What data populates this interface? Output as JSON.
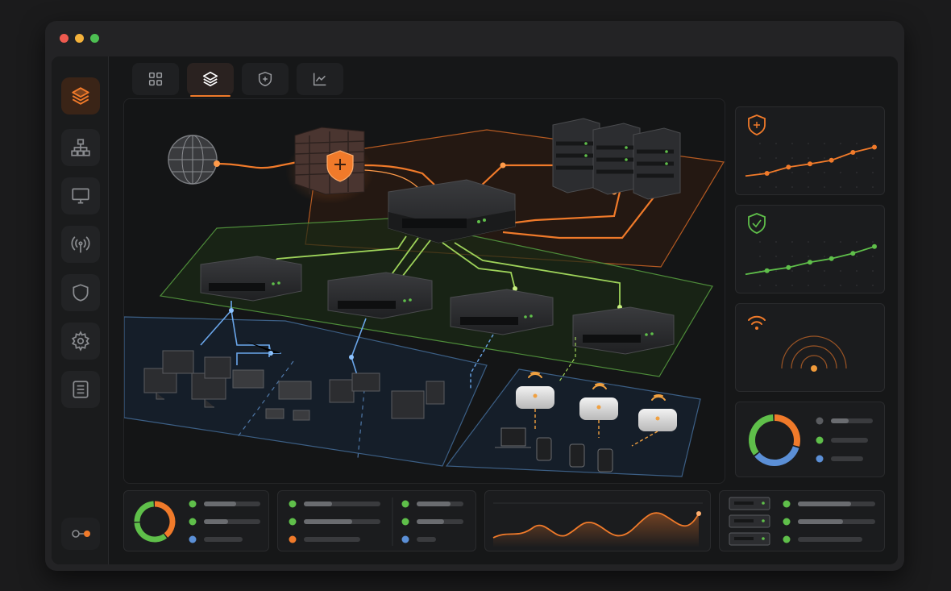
{
  "window": {
    "controls": [
      "close",
      "minimize",
      "maximize"
    ],
    "control_colors": [
      "#ee5a4f",
      "#f4b23b",
      "#4dbf52"
    ]
  },
  "sidebar": {
    "items": [
      {
        "name": "layers",
        "icon": "layers-icon",
        "active": true
      },
      {
        "name": "topology",
        "icon": "hierarchy-icon",
        "active": false
      },
      {
        "name": "devices",
        "icon": "monitor-icon",
        "active": false
      },
      {
        "name": "wireless",
        "icon": "antenna-icon",
        "active": false
      },
      {
        "name": "security",
        "icon": "shield-icon",
        "active": false
      },
      {
        "name": "settings",
        "icon": "gear-icon",
        "active": false
      },
      {
        "name": "logs",
        "icon": "list-icon",
        "active": false
      }
    ],
    "bottom_toggle": "toggle-icon"
  },
  "tabs": [
    {
      "name": "grid",
      "icon": "grid-icon",
      "active": false
    },
    {
      "name": "layers",
      "icon": "layers-icon",
      "active": true
    },
    {
      "name": "security",
      "icon": "shield-icon",
      "active": false
    },
    {
      "name": "analytics",
      "icon": "line-chart-icon",
      "active": false
    }
  ],
  "colors": {
    "accent": "#f07a2a",
    "green": "#5fbf4a",
    "blue": "#5b8fd6",
    "gray": "#8a8c90"
  },
  "right_cards": [
    {
      "icon": "shield-icon",
      "color": "#f07a2a",
      "trend": [
        0.15,
        0.2,
        0.32,
        0.38,
        0.45,
        0.6,
        0.7
      ]
    },
    {
      "icon": "shield-icon",
      "color": "#5fbf4a",
      "trend": [
        0.15,
        0.22,
        0.28,
        0.38,
        0.45,
        0.55,
        0.68
      ]
    },
    {
      "icon": "wifi-icon",
      "color": "#f07a2a"
    },
    {
      "icon": "donut-icon",
      "segments": [
        0.3,
        0.35,
        0.35
      ]
    }
  ],
  "bottom_panels": [
    {
      "type": "donut"
    },
    {
      "type": "status-list"
    },
    {
      "type": "wave-chart"
    },
    {
      "type": "server-list"
    }
  ]
}
